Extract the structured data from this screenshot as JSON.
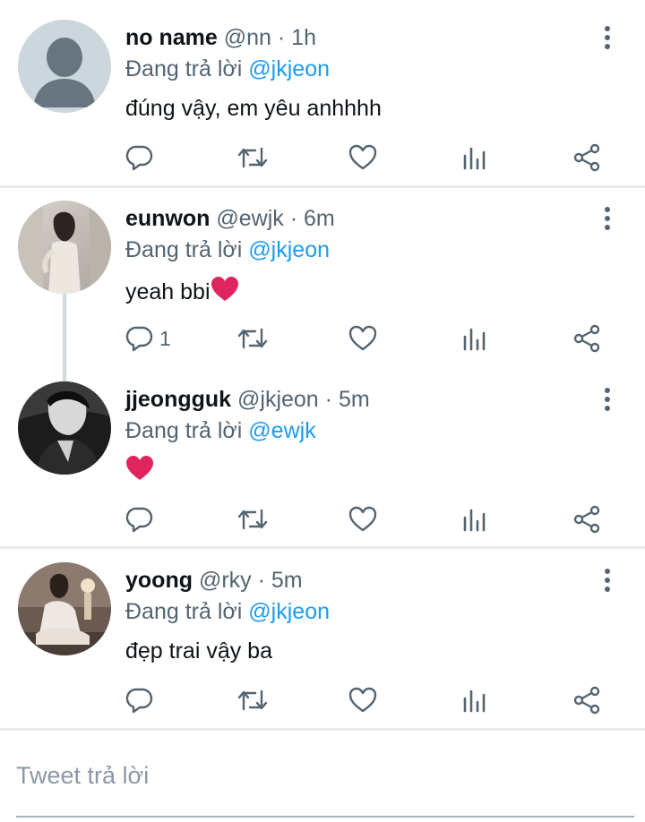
{
  "colors": {
    "accent": "#1d9bf0",
    "secondary_text": "#536471",
    "icon": "#536471",
    "heart": "#e0245e"
  },
  "tweets": [
    {
      "name": "no name",
      "handle": "@nn",
      "time": "1h",
      "reply_prefix": "Đang trả lời",
      "mention": "@jkjeon",
      "text": "đúng vậy, em yêu anhhhh",
      "reply_count": ""
    },
    {
      "name": "eunwon",
      "handle": "@ewjk",
      "time": "6m",
      "reply_prefix": "Đang trả lời",
      "mention": "@jkjeon",
      "text": "yeah bbi",
      "reply_count": "1"
    },
    {
      "name": "jjeongguk",
      "handle": "@jkjeon",
      "time": "5m",
      "reply_prefix": "Đang trả lời",
      "mention": "@ewjk",
      "text": "",
      "reply_count": ""
    },
    {
      "name": "yoong",
      "handle": "@rky",
      "time": "5m",
      "reply_prefix": "Đang trả lời",
      "mention": "@jkjeon",
      "text": "đẹp trai vậy ba",
      "reply_count": ""
    }
  ],
  "separator": "·",
  "icons": [
    "reply-icon",
    "retweet-icon",
    "like-icon",
    "analytics-icon",
    "share-icon",
    "more-icon",
    "heart-emoji-icon"
  ],
  "compose": {
    "placeholder": "Tweet trả lời"
  }
}
